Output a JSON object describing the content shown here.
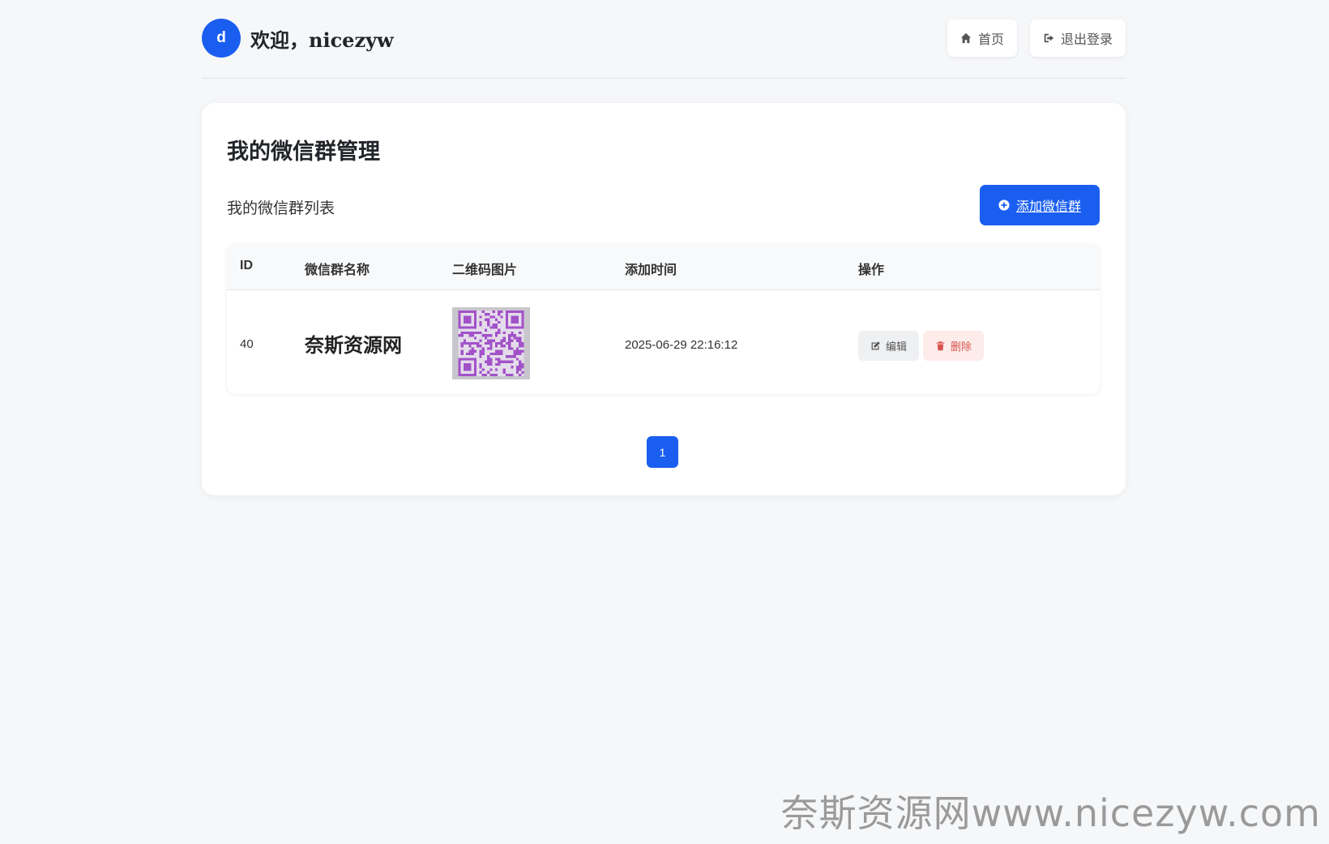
{
  "header": {
    "avatar_letter": "d",
    "welcome": "欢迎，nicezyw",
    "nav": [
      {
        "label": "首页",
        "icon": "home-icon"
      },
      {
        "label": "退出登录",
        "icon": "logout-icon"
      }
    ]
  },
  "main": {
    "title": "我的微信群管理",
    "list_title": "我的微信群列表",
    "add_button": "添加微信群",
    "table": {
      "columns": [
        "ID",
        "微信群名称",
        "二维码图片",
        "添加时间",
        "操作"
      ],
      "rows": [
        {
          "id": "40",
          "name": "奈斯资源网",
          "time": "2025-06-29 22:16:12",
          "edit": "编辑",
          "delete": "删除"
        }
      ]
    },
    "pagination": {
      "current": "1"
    }
  },
  "watermark": "奈斯资源网www.nicezyw.com",
  "colors": {
    "primary": "#1a5ef0",
    "danger": "#d9534f",
    "qr": "#a252c9"
  }
}
